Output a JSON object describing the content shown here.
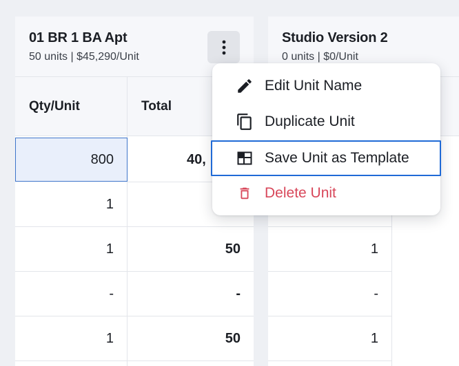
{
  "units": [
    {
      "title": "01 BR 1 BA Apt",
      "subtitle": "50 units | $45,290/Unit"
    },
    {
      "title": "Studio Version 2",
      "subtitle": "0 units | $0/Unit"
    }
  ],
  "columns": {
    "qty_per_unit": "Qty/Unit",
    "total": "Total"
  },
  "rows": [
    {
      "qty": "800",
      "total": "40,",
      "qty2": ""
    },
    {
      "qty": "1",
      "total": "",
      "qty2": ""
    },
    {
      "qty": "1",
      "total": "50",
      "qty2": "1"
    },
    {
      "qty": "-",
      "total": "-",
      "qty2": "-"
    },
    {
      "qty": "1",
      "total": "50",
      "qty2": "1"
    }
  ],
  "menu": {
    "items": [
      {
        "label": "Edit Unit Name",
        "icon": "pencil-icon"
      },
      {
        "label": "Duplicate Unit",
        "icon": "duplicate-icon"
      },
      {
        "label": "Save Unit as Template",
        "icon": "template-icon"
      },
      {
        "label": "Delete Unit",
        "icon": "trash-icon"
      }
    ]
  },
  "colors": {
    "accent": "#1f6ad6",
    "danger": "#d8475a",
    "selected_cell": "#e9effb"
  }
}
